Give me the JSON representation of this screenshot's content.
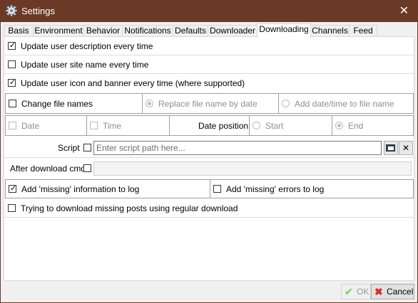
{
  "window": {
    "title": "Settings",
    "close_glyph": "✕"
  },
  "tabs": [
    {
      "label": "Basis"
    },
    {
      "label": "Environment"
    },
    {
      "label": "Behavior"
    },
    {
      "label": "Notifications"
    },
    {
      "label": "Defaults"
    },
    {
      "label": "Downloader"
    },
    {
      "label": "Downloading",
      "active": true
    },
    {
      "label": "Channels"
    },
    {
      "label": "Feed"
    }
  ],
  "options": {
    "update_description": {
      "label": "Update user description every time",
      "checked": true
    },
    "update_site_name": {
      "label": "Update user site name every time",
      "checked": false
    },
    "update_icon_banner": {
      "label": "Update user icon and banner every time (where supported)",
      "checked": true
    }
  },
  "file_names": {
    "change_label": "Change file names",
    "replace_label": "Replace file name by date",
    "add_label": "Add date/time to file name",
    "date_label": "Date",
    "time_label": "Time",
    "position_label": "Date position:",
    "start_label": "Start",
    "end_label": "End"
  },
  "script": {
    "label": "Script",
    "placeholder": "Enter script path here...",
    "open_icon": "folder-open-icon",
    "clear_glyph": "✕"
  },
  "after_download": {
    "label": "After download cmd",
    "value": ""
  },
  "missing": {
    "info_label": "Add 'missing' information to log",
    "info_checked": true,
    "errors_label": "Add 'missing' errors to log",
    "errors_checked": false,
    "regular_label": "Trying to download missing posts using regular download",
    "regular_checked": false
  },
  "buttons": {
    "ok_label": "OK",
    "ok_glyph": "✔",
    "cancel_label": "Cancel",
    "cancel_glyph": "✖"
  },
  "colors": {
    "title_bar": "#6b3a26",
    "ok_green": "#5fcf3a",
    "cancel_red": "#e0262b"
  }
}
